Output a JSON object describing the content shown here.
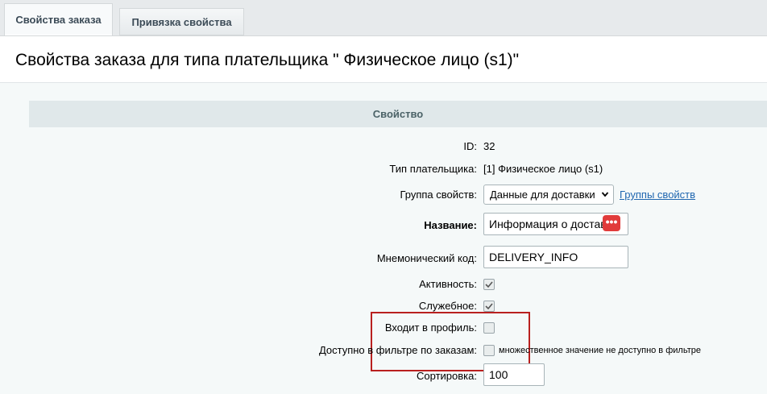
{
  "tabs": [
    {
      "label": "Свойства заказа",
      "active": true
    },
    {
      "label": "Привязка свойства",
      "active": false
    }
  ],
  "page_title": "Свойства заказа для типа плательщика \" Физическое лицо (s1)\"",
  "section_header": "Свойство",
  "fields": {
    "id": {
      "label": "ID:",
      "value": "32"
    },
    "payer_type": {
      "label": "Тип плательщика:",
      "value": "[1] Физическое лицо (s1)"
    },
    "group": {
      "label": "Группа свойств:",
      "value": "Данные для доставки",
      "link": "Группы свойств"
    },
    "name": {
      "label": "Название:",
      "value": "Информация о доставке"
    },
    "code": {
      "label": "Мнемонический код:",
      "value": "DELIVERY_INFO"
    },
    "active": {
      "label": "Активность:",
      "checked": true
    },
    "service": {
      "label": "Служебное:",
      "checked": true
    },
    "in_profile": {
      "label": "Входит в профиль:",
      "checked": false
    },
    "filter": {
      "label": "Доступно в фильтре по заказам:",
      "checked": false,
      "hint": "множественное значение не доступно в фильтре"
    },
    "sort": {
      "label": "Сортировка:",
      "value": "100"
    }
  },
  "colors": {
    "highlight": "#b9201f",
    "link": "#2067b0",
    "badge": "#e13b3b"
  }
}
